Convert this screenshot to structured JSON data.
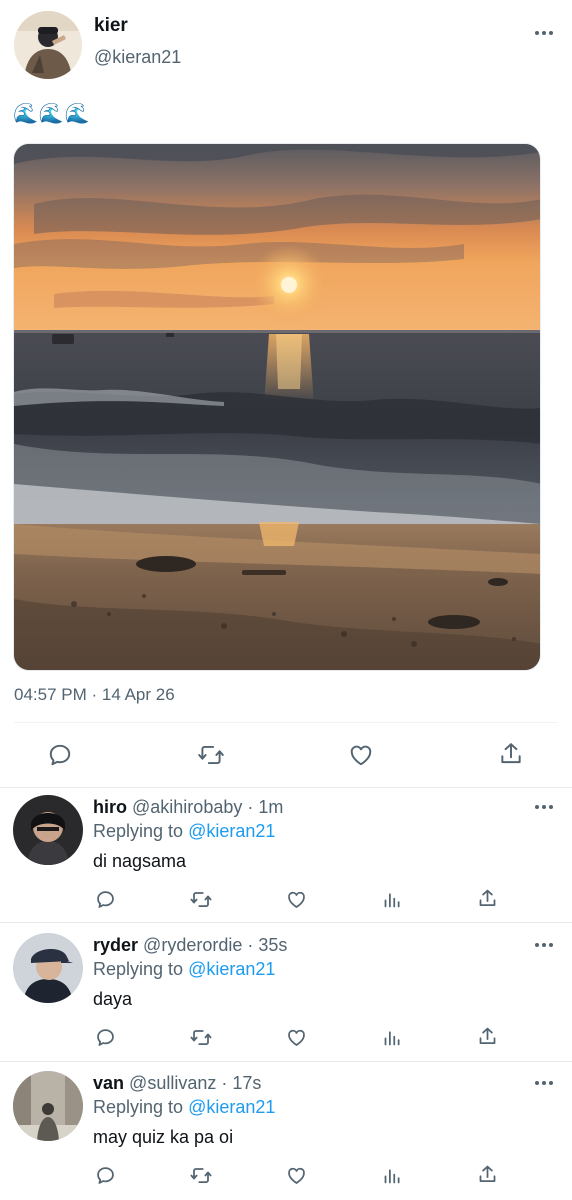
{
  "tweet": {
    "author_name": "kier",
    "author_handle": "@kieran21",
    "text": "🌊🌊🌊",
    "timestamp": "04:57 PM · 14 Apr 26",
    "photo": "sunset-beach-photo"
  },
  "actions": [
    "reply-icon",
    "retweet-icon",
    "like-icon",
    "share-icon"
  ],
  "replies": [
    {
      "name": "hiro",
      "handle": "@akihirobaby",
      "dot": "·",
      "time": "1m",
      "replying_prefix": "Replying to",
      "replying_to": "@kieran21",
      "text": "di nagsama"
    },
    {
      "name": "ryder",
      "handle": "@ryderordie",
      "dot": "·",
      "time": "35s",
      "replying_prefix": "Replying to",
      "replying_to": "@kieran21",
      "text": "daya"
    },
    {
      "name": "van",
      "handle": "@sullivanz",
      "dot": "·",
      "time": "17s",
      "replying_prefix": "Replying to",
      "replying_to": "@kieran21",
      "text": "may quiz ka pa oi"
    }
  ],
  "colors": {
    "text_primary": "#0f1419",
    "text_secondary": "#536471",
    "link": "#1d9bf0",
    "divider": "#eff3f4"
  }
}
